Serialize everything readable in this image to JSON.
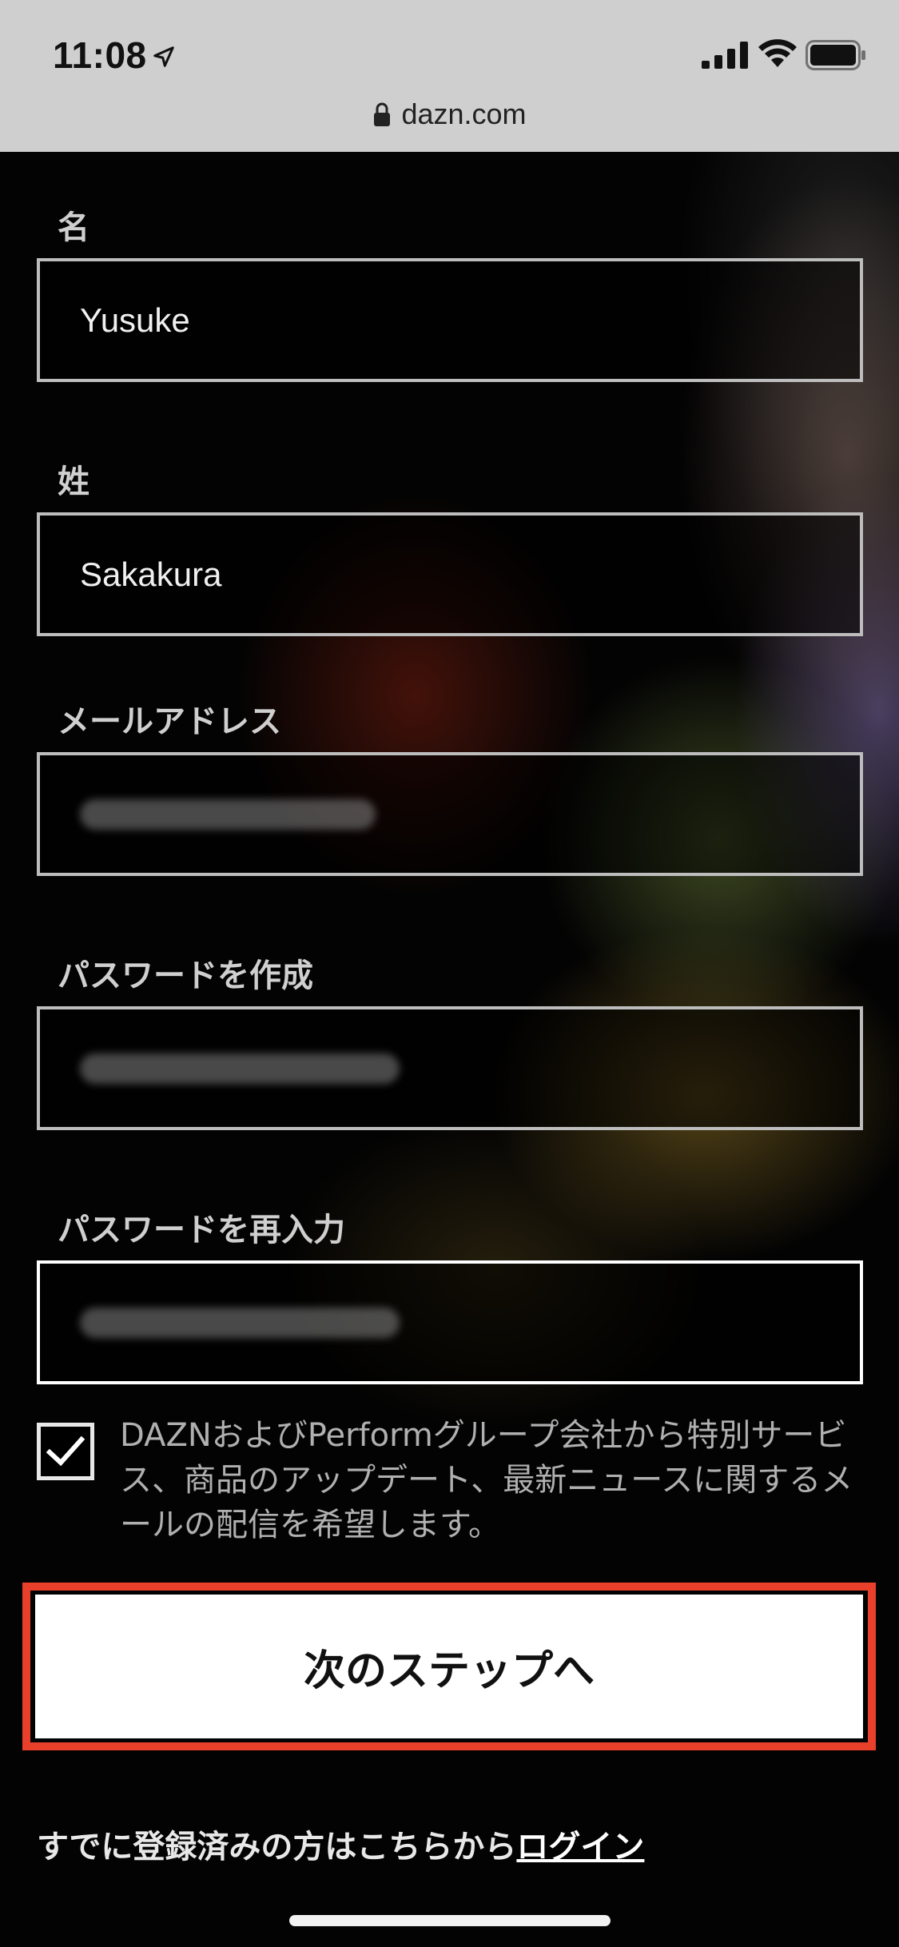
{
  "status_bar": {
    "time": "11:08",
    "icons": [
      "location-arrow-icon",
      "cellular-signal-icon",
      "wifi-icon",
      "battery-icon"
    ]
  },
  "browser": {
    "url": "dazn.com",
    "lock_icon": "lock-icon"
  },
  "form": {
    "first_name": {
      "label": "名",
      "value": "Yusuke"
    },
    "last_name": {
      "label": "姓",
      "value": "Sakakura"
    },
    "email": {
      "label": "メールアドレス"
    },
    "password": {
      "label": "パスワードを作成"
    },
    "password_confirm": {
      "label": "パスワードを再入力"
    },
    "consent": {
      "checked": true,
      "text": "DAZNおよびPerformグループ会社から特別サービス、商品のアップデート、最新ニュースに関するメールの配信を希望します。"
    },
    "next_button": "次のステップへ"
  },
  "footer": {
    "login_prompt": "すでに登録済みの方はこちらから",
    "login_link": "ログイン"
  },
  "colors": {
    "highlight": "#e8402b",
    "field_border": "#bdbdbd",
    "button_bg": "#ffffff"
  }
}
